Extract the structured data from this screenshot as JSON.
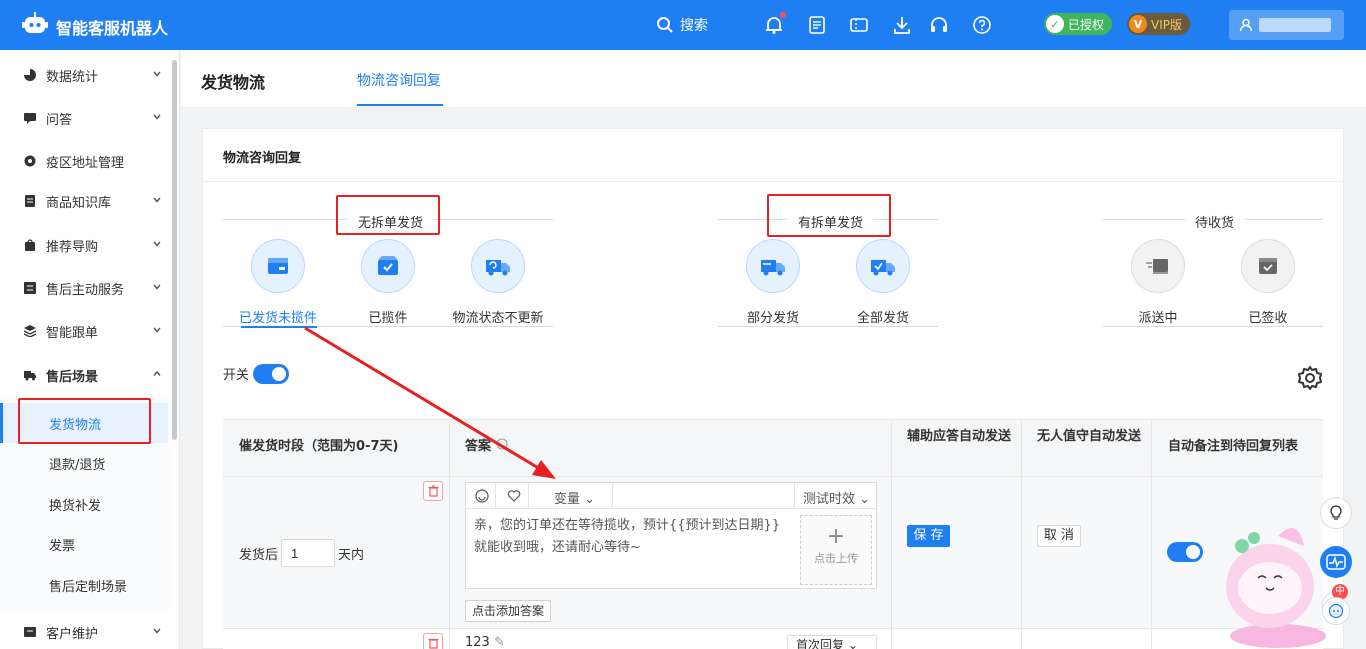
{
  "header": {
    "app_title": "智能客服机器人",
    "search_label": "搜索",
    "auth_badge": "已授权",
    "vip_badge": "VIP版",
    "colors": {
      "brand": "#1f7ff2",
      "auth": "#3fb65b",
      "vip": "#6b5b3b"
    }
  },
  "sidebar": {
    "items": [
      {
        "label": "数据统计",
        "icon": "pie-chart-icon"
      },
      {
        "label": "问答",
        "icon": "chat-icon"
      },
      {
        "label": "疫区地址管理",
        "icon": "location-icon"
      },
      {
        "label": "商品知识库",
        "icon": "book-icon"
      },
      {
        "label": "推荐导购",
        "icon": "bag-icon"
      },
      {
        "label": "售后主动服务",
        "icon": "list-icon"
      },
      {
        "label": "智能跟单",
        "icon": "layers-icon"
      },
      {
        "label": "售后场景",
        "icon": "truck-icon"
      }
    ],
    "sub_items": [
      {
        "label": "发货物流"
      },
      {
        "label": "退款/退货"
      },
      {
        "label": "换货补发"
      },
      {
        "label": "发票"
      },
      {
        "label": "售后定制场景"
      }
    ],
    "bottom_item": {
      "label": "客户维护",
      "icon": "customer-icon"
    }
  },
  "page": {
    "title": "发货物流",
    "tab": "物流咨询回复"
  },
  "card": {
    "title": "物流咨询回复",
    "groups": [
      {
        "label": "无拆单发货"
      },
      {
        "label": "有拆单发货"
      },
      {
        "label": "待收货"
      }
    ],
    "categories": [
      {
        "label": "已发货未揽件"
      },
      {
        "label": "已揽件"
      },
      {
        "label": "物流状态不更新"
      },
      {
        "label": "部分发货"
      },
      {
        "label": "全部发货"
      },
      {
        "label": "派送中"
      },
      {
        "label": "已签收"
      }
    ],
    "switch_label": "开关"
  },
  "table": {
    "headers": {
      "period": "催发货时段（范围为0-7天)",
      "answer": "答案",
      "assist": "辅助应答自动发送",
      "unattended": "无人值守自动发送",
      "auto_note": "自动备注到待回复列表"
    },
    "row1": {
      "period_prefix": "发货后",
      "period_value": "1",
      "period_unit": "天内",
      "variable_label": "变量",
      "test_label": "测试时效",
      "answer_text": "亲，您的订单还在等待揽收，预计{{预计到达日期}}就能收到哦，还请耐心等待~",
      "upload_label": "点击上传",
      "add_answer": "点击添加答案",
      "save": "保 存",
      "cancel": "取 消"
    },
    "row2": {
      "text": "123",
      "select": "首次回复"
    }
  },
  "floating": {
    "mascot_badge": "中"
  }
}
